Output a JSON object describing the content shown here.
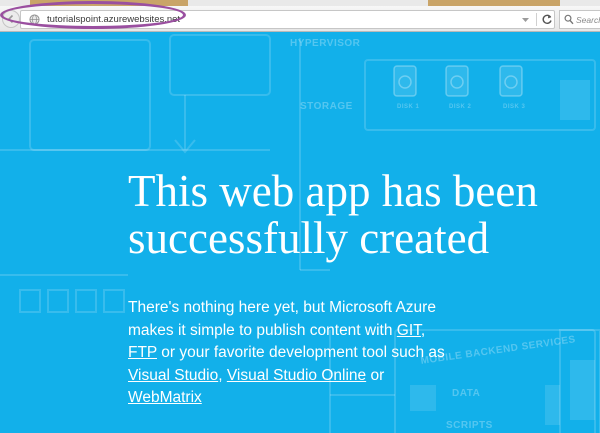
{
  "browser": {
    "url": "tutorialspoint.azurewebsites.net",
    "search_placeholder": "Search"
  },
  "background_labels": {
    "hypervisor": "HYPERVISOR",
    "storage": "STORAGE",
    "disk_1": "DISK 1",
    "disk_2": "DISK 2",
    "disk_3": "DISK 3",
    "mobile_backend_services": "MOBILE BACKEND SERVICES",
    "data": "DATA",
    "scripts": "SCRIPTS"
  },
  "page": {
    "headline": "This web app has been successfully created",
    "intro": "There's nothing here yet, but Microsoft Azure makes it simple to publish content with ",
    "link_git": "GIT",
    "sep_1": ", ",
    "link_ftp": "FTP",
    "text_2": " or your favorite development tool such as ",
    "link_visual_studio": "Visual Studio",
    "sep_2": ", ",
    "link_visual_studio_online": "Visual Studio Online",
    "text_3": " or ",
    "link_webmatrix": "WebMatrix"
  },
  "colors": {
    "page_background": "#12b0ea",
    "headline_text": "#ffffff",
    "annotation_oval": "#9a4fa0"
  }
}
